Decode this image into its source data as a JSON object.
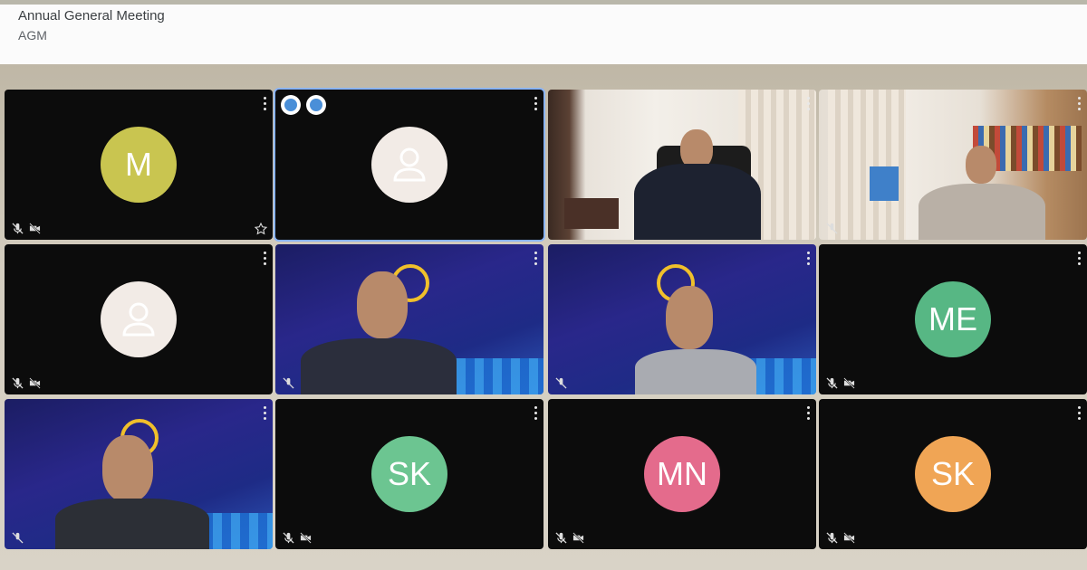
{
  "meeting": {
    "title": "Annual General Meeting",
    "subtitle": "AGM"
  },
  "colors": {
    "header_bg": "#fbfbfb",
    "tile_bg": "#0c0c0c",
    "active_border": "#8ab4f8",
    "avatar_M": "#c9c550",
    "avatar_ME": "#57b784",
    "avatar_SK_green": "#6cc591",
    "avatar_MN": "#e46b8c",
    "avatar_SK_orange": "#f0a555"
  },
  "tiles": [
    {
      "kind": "initials",
      "initials": "M",
      "color": "#c9c550",
      "pinned_star": true
    },
    {
      "kind": "placeholder",
      "reactions": [
        "smile-reaction-icon",
        "raise-hand-reaction-icon"
      ],
      "active": true
    },
    {
      "kind": "video",
      "scene": "office-man-dark-suit"
    },
    {
      "kind": "video",
      "scene": "study-man-grey-suit"
    },
    {
      "kind": "placeholder"
    },
    {
      "kind": "video",
      "scene": "banner-man-glasses-beard"
    },
    {
      "kind": "video",
      "scene": "banner-man-grey-hair"
    },
    {
      "kind": "initials",
      "initials": "ME",
      "color": "#57b784"
    },
    {
      "kind": "video",
      "scene": "banner-man-dark-suit"
    },
    {
      "kind": "initials",
      "initials": "SK",
      "color": "#6cc591"
    },
    {
      "kind": "initials",
      "initials": "MN",
      "color": "#e46b8c"
    },
    {
      "kind": "initials",
      "initials": "SK",
      "color": "#f0a555"
    }
  ]
}
